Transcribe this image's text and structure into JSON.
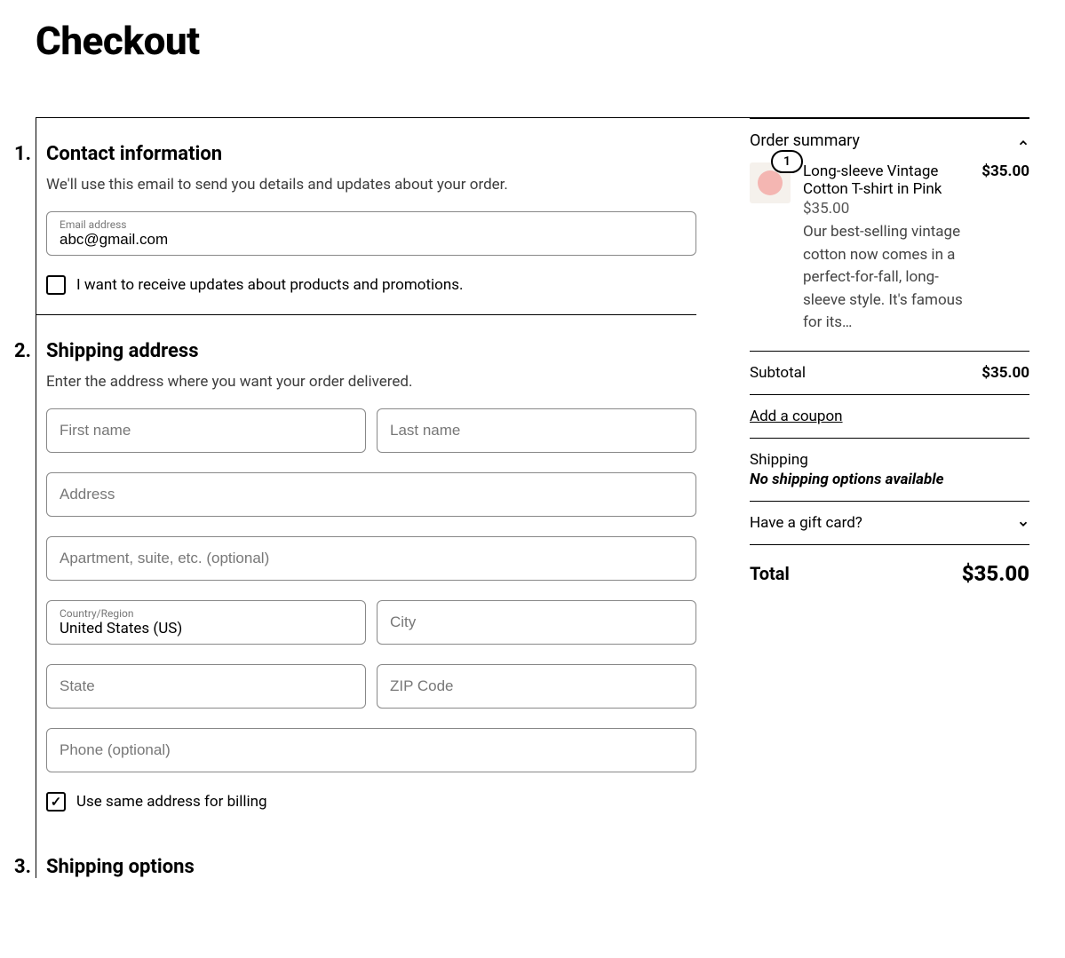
{
  "title": "Checkout",
  "steps": [
    {
      "num": "1.",
      "title": "Contact information",
      "desc": "We'll use this email to send you details and updates about your order.",
      "email_label": "Email address",
      "email_value": "abc@gmail.com",
      "updates_checked": false,
      "updates_label": "I want to receive updates about products and promotions."
    },
    {
      "num": "2.",
      "title": "Shipping address",
      "desc": "Enter the address where you want your order delivered.",
      "first_name_ph": "First name",
      "last_name_ph": "Last name",
      "address_ph": "Address",
      "apt_ph": "Apartment, suite, etc. (optional)",
      "country_label": "Country/Region",
      "country_value": "United States (US)",
      "city_ph": "City",
      "state_ph": "State",
      "zip_ph": "ZIP Code",
      "phone_ph": "Phone (optional)",
      "same_billing_checked": true,
      "same_billing_label": "Use same address for billing"
    },
    {
      "num": "3.",
      "title": "Shipping options"
    }
  ],
  "summary": {
    "header": "Order summary",
    "item": {
      "qty": "1",
      "name": "Long-sleeve Vintage Cotton T-shirt in Pink",
      "unit_price": "$35.00",
      "desc": "Our best-selling vintage cotton now comes in a perfect-for-fall, long-sleeve style. It's famous for its…",
      "line_price": "$35.00"
    },
    "subtotal_label": "Subtotal",
    "subtotal": "$35.00",
    "coupon": "Add a coupon",
    "shipping_label": "Shipping",
    "shipping_note": "No shipping options available",
    "gift_card": "Have a gift card?",
    "total_label": "Total",
    "total": "$35.00"
  }
}
